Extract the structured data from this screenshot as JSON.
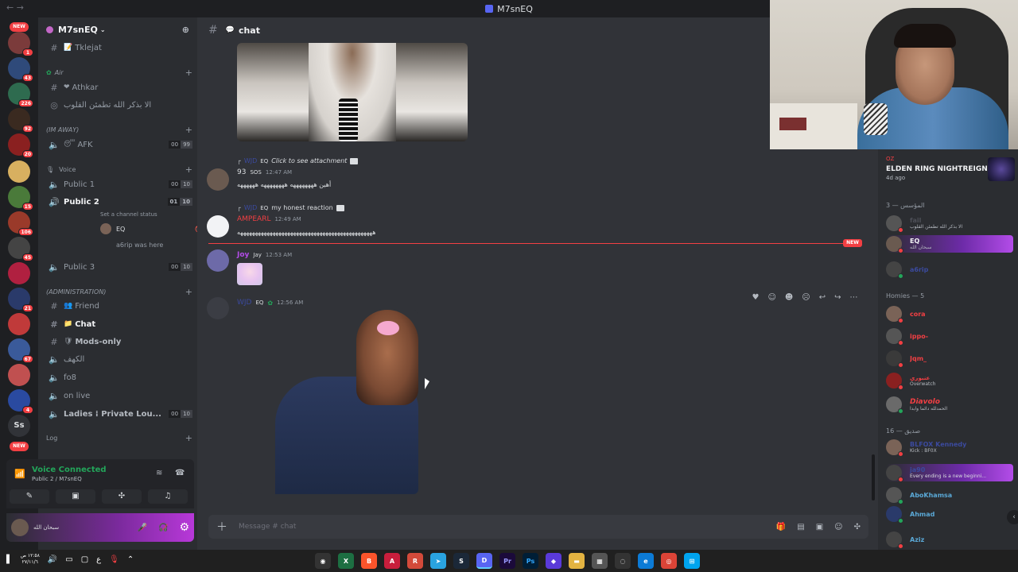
{
  "window": {
    "title": "M7snEQ"
  },
  "server": {
    "name": "M7snEQ"
  },
  "rail": {
    "new_top": "NEW",
    "new_bottom": "NEW",
    "badges": [
      "1",
      "43",
      "226",
      "92",
      "20",
      "15",
      "106",
      "45",
      "21",
      "67",
      "4"
    ],
    "ss": "Ss"
  },
  "channels": {
    "tklejat": "Tklejat",
    "cat_air": "Air",
    "athkar": "Athkar",
    "dhikr": "الا بذكر الله تطمئن القلوب",
    "cat_away": "(IM AWAY)",
    "afk": "AFK",
    "afk_limit": [
      "00",
      "99"
    ],
    "cat_voice": "Voice",
    "public1": "Public 1",
    "public1_limit": [
      "00",
      "10"
    ],
    "public2": "Public 2",
    "public2_limit": [
      "01",
      "10"
    ],
    "public2_status": "Set a channel status",
    "voice_user": "EQ",
    "voice_join": "a6rip was here",
    "public3": "Public 3",
    "public3_limit": [
      "00",
      "10"
    ],
    "cat_admin": "(ADMINISTRATION)",
    "friend": "Friend",
    "chat": "Chat",
    "mods": "Mods-only",
    "alkahf": "الكهف",
    "fo8": "fo8",
    "onlive": "on live",
    "ladies": "Ladies ⁞ Private Lou...",
    "ladies_limit": [
      "00",
      "10"
    ],
    "cat_log": "Log"
  },
  "voice_panel": {
    "title": "Voice Connected",
    "subtitle": "Public 2 / M7snEQ"
  },
  "user_panel": {
    "status": "سبحان الله"
  },
  "chat": {
    "header": "chat",
    "messages": [
      {
        "reply_name": "WJD",
        "reply_tag": "EQ",
        "reply_text": "Click to see attachment",
        "user": "93",
        "user_tag": "SOS",
        "time": "12:47 AM",
        "text": "أهين ههههههههه ههههههههه ههههههه"
      },
      {
        "reply_name": "WJD",
        "reply_tag": "EQ",
        "reply_text": "my honest reaction",
        "user": "AMPEARL",
        "time": "12:49 AM",
        "text": "ههههههههههههههههههههههههههههههههههههههههههههههه"
      },
      {
        "user": "Joy",
        "user_tag": "Jay",
        "time": "12:53 AM"
      },
      {
        "user": "WJD",
        "user_tag": "EQ",
        "time": "12:56 AM"
      }
    ],
    "new_label": "NEW",
    "placeholder": "Message # chat"
  },
  "members": {
    "activity_small": "OZ",
    "activity_game": "ELDEN RING NIGHTREIGN",
    "activity_ago": "4d ago",
    "group_founder": "المؤسس — 3",
    "founder": [
      {
        "name": "fail",
        "status": "الا بذكر الله تطمئن القلوب"
      },
      {
        "name": "EQ",
        "status": "سبحان الله"
      },
      {
        "name": "a6rip",
        "status": ""
      }
    ],
    "group_homies": "Homies — 5",
    "homies": [
      {
        "name": "cora",
        "status": ""
      },
      {
        "name": "ippo-",
        "status": ""
      },
      {
        "name": "Jqm_",
        "status": ""
      },
      {
        "name": "عنبوري",
        "status": "Overwatch"
      },
      {
        "name": "Diavolo",
        "status": "الحمدلله دائما وابدا"
      }
    ],
    "group_friends": "صديق — 16",
    "friends": [
      {
        "name": "BLFOX Kennedy",
        "status": "Kick : BF0X"
      },
      {
        "name": "ja90",
        "status": "Every ending is a new beginni..."
      },
      {
        "name": "AboKhamsa",
        "status": ""
      },
      {
        "name": "Ahmad",
        "status": ""
      },
      {
        "name": "Aziz",
        "status": ""
      }
    ]
  },
  "taskbar": {
    "time": "١٢:٥٨ ص",
    "date": "٢٧/١١/٦"
  },
  "colors": {
    "accent": "#5865f2",
    "danger": "#f23f43",
    "online": "#23a55a"
  }
}
